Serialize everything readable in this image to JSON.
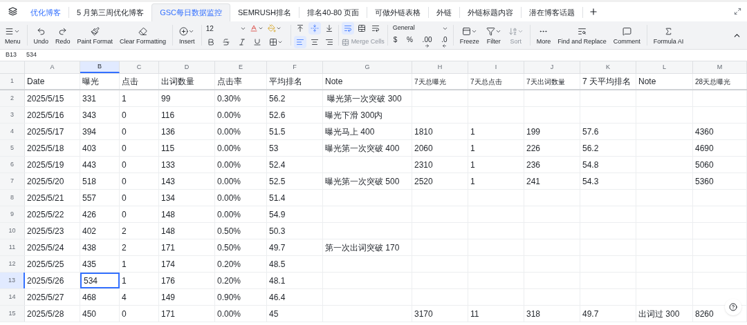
{
  "sheet_tabs": [
    {
      "label": "优化博客",
      "selected": false,
      "kind": "highlighted"
    },
    {
      "label": "5 月第三周优化博客",
      "selected": false,
      "kind": "normal"
    },
    {
      "label": "GSC每日数据监控",
      "selected": true,
      "kind": "normal"
    },
    {
      "label": "SEMRUSH排名",
      "selected": false,
      "kind": "normal"
    },
    {
      "label": "排名40-80 页面",
      "selected": false,
      "kind": "normal"
    },
    {
      "label": "可做外链表格",
      "selected": false,
      "kind": "normal"
    },
    {
      "label": "外链",
      "selected": false,
      "kind": "normal"
    },
    {
      "label": "外链标题内容",
      "selected": false,
      "kind": "normal"
    },
    {
      "label": "潜在博客话题",
      "selected": false,
      "kind": "normal"
    }
  ],
  "toolbar": {
    "actions_left": [
      {
        "label": "Menu",
        "disabled": false
      },
      {
        "label": "Undo",
        "disabled": false
      },
      {
        "label": "Redo",
        "disabled": false
      },
      {
        "label": "Paint Format",
        "disabled": false
      },
      {
        "label": "Clear Formatting",
        "disabled": false
      },
      {
        "label": "Insert",
        "disabled": false
      }
    ],
    "font_size": "12",
    "vertical_align": [
      {
        "selected": false
      },
      {
        "selected": true
      },
      {
        "selected": false
      }
    ],
    "horizontal_align": [
      {
        "selected": true
      },
      {
        "selected": false
      },
      {
        "selected": false
      }
    ],
    "wrap": {
      "selected": true
    },
    "merge": {
      "label": "Merge Cells",
      "disabled": true
    },
    "number_format": "General",
    "number_buttons": [
      "$",
      "%",
      ".00",
      ".0"
    ],
    "actions_right": [
      {
        "label": "Freeze",
        "disabled": false
      },
      {
        "label": "Filter",
        "disabled": false
      },
      {
        "label": "Sort",
        "disabled": true
      },
      {
        "label": "More",
        "disabled": false
      },
      {
        "label": "Find and Replace",
        "disabled": false
      },
      {
        "label": "Comment",
        "disabled": false
      },
      {
        "label": "Formula AI",
        "disabled": false
      }
    ]
  },
  "formula_bar": {
    "cell": "B13",
    "value": "534"
  },
  "table": {
    "columns": [
      {
        "label": "A",
        "selected": false
      },
      {
        "label": "B",
        "selected": true
      },
      {
        "label": "C",
        "selected": false
      },
      {
        "label": "D",
        "selected": false
      },
      {
        "label": "E",
        "selected": false
      },
      {
        "label": "F",
        "selected": false
      },
      {
        "label": "G",
        "selected": false
      },
      {
        "label": "H",
        "selected": false
      },
      {
        "label": "I",
        "selected": false
      },
      {
        "label": "J",
        "selected": false
      },
      {
        "label": "K",
        "selected": false
      },
      {
        "label": "L",
        "selected": false
      },
      {
        "label": "M",
        "selected": false
      }
    ],
    "header_row": {
      "number": "1",
      "cells": [
        {
          "text": "Date",
          "small": false
        },
        {
          "text": "曝光",
          "small": false
        },
        {
          "text": "点击",
          "small": false
        },
        {
          "text": "出词数量",
          "small": false
        },
        {
          "text": "点击率",
          "small": false
        },
        {
          "text": "平均排名",
          "small": false
        },
        {
          "text": "Note",
          "small": false
        },
        {
          "text": "7天总曝光",
          "small": true
        },
        {
          "text": "7天总点击",
          "small": true
        },
        {
          "text": "7天出词数量",
          "small": true
        },
        {
          "text": "7 天平均排名",
          "small": false
        },
        {
          "text": "Note",
          "small": false
        },
        {
          "text": "28天总曝光",
          "small": true
        }
      ]
    },
    "rows": [
      {
        "number": "2",
        "selected": false,
        "cells": [
          "2025/5/15",
          "331",
          "1",
          "99",
          "0.30%",
          "56.2",
          " 曝光第一次突破 300",
          null,
          null,
          null,
          null,
          null,
          null
        ]
      },
      {
        "number": "3",
        "selected": false,
        "cells": [
          "2025/5/16",
          "343",
          "0",
          "116",
          "0.00%",
          "52.6",
          "曝光下滑 300内",
          null,
          null,
          null,
          null,
          null,
          null
        ]
      },
      {
        "number": "4",
        "selected": false,
        "cells": [
          "2025/5/17",
          "394",
          "0",
          "136",
          "0.00%",
          "51.5",
          "曝光马上 400",
          "1810",
          "1",
          "199",
          "57.6",
          null,
          "4360"
        ]
      },
      {
        "number": "5",
        "selected": false,
        "cells": [
          "2025/5/18",
          "403",
          "0",
          "115",
          "0.00%",
          "53",
          "曝光第一次突破 400",
          "2060",
          "1",
          "226",
          "56.2",
          null,
          "4690"
        ]
      },
      {
        "number": "6",
        "selected": false,
        "cells": [
          "2025/5/19",
          "443",
          "0",
          "133",
          "0.00%",
          "52.4",
          null,
          "2310",
          "1",
          "236",
          "54.8",
          null,
          "5060"
        ]
      },
      {
        "number": "7",
        "selected": false,
        "cells": [
          "2025/5/20",
          "518",
          "0",
          "143",
          "0.00%",
          "52.5",
          "曝光第一次突破 500",
          "2520",
          "1",
          "241",
          "54.3",
          null,
          "5360"
        ]
      },
      {
        "number": "8",
        "selected": false,
        "cells": [
          "2025/5/21",
          "557",
          "0",
          "134",
          "0.00%",
          "51.4",
          null,
          null,
          null,
          null,
          null,
          null,
          null
        ]
      },
      {
        "number": "9",
        "selected": false,
        "cells": [
          "2025/5/22",
          "426",
          "0",
          "148",
          "0.00%",
          "54.9",
          null,
          null,
          null,
          null,
          null,
          null,
          null
        ]
      },
      {
        "number": "10",
        "selected": false,
        "cells": [
          "2025/5/23",
          "402",
          "2",
          "148",
          "0.50%",
          "50.3",
          null,
          null,
          null,
          null,
          null,
          null,
          null
        ]
      },
      {
        "number": "11",
        "selected": false,
        "cells": [
          "2025/5/24",
          "438",
          "2",
          "171",
          "0.50%",
          "49.7",
          "第一次出词突破 170",
          null,
          null,
          null,
          null,
          null,
          null
        ]
      },
      {
        "number": "12",
        "selected": false,
        "cells": [
          "2025/5/25",
          "435",
          "1",
          "174",
          "0.20%",
          "48.5",
          null,
          null,
          null,
          null,
          null,
          null,
          null
        ]
      },
      {
        "number": "13",
        "selected": true,
        "cells": [
          "2025/5/26",
          "534",
          "1",
          "176",
          "0.20%",
          "48.1",
          null,
          null,
          null,
          null,
          null,
          null,
          null
        ]
      },
      {
        "number": "14",
        "selected": false,
        "cells": [
          "2025/5/27",
          "468",
          "4",
          "149",
          "0.90%",
          "46.4",
          null,
          null,
          null,
          null,
          null,
          null,
          null
        ]
      },
      {
        "number": "15",
        "selected": false,
        "cells": [
          "2025/5/28",
          "450",
          "0",
          "171",
          "0.00%",
          "45",
          null,
          "3170",
          "11",
          "318",
          "49.7",
          "出词过 300",
          "8260"
        ]
      }
    ]
  }
}
